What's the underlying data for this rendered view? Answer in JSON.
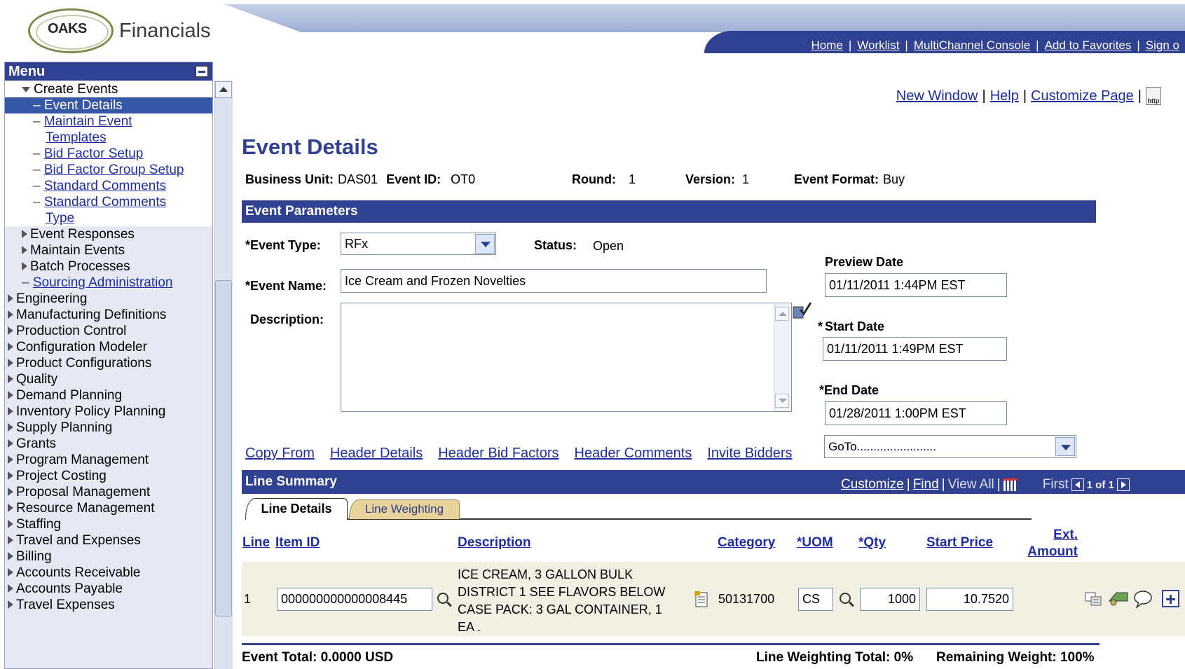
{
  "header": {
    "logo_text": "OAKS",
    "brand": "Financials",
    "nav": [
      "Home",
      "Worklist",
      "MultiChannel Console",
      "Add to Favorites",
      "Sign o"
    ]
  },
  "menu": {
    "title": "Menu",
    "items": [
      {
        "label": "Create Events",
        "level": 1,
        "type": "open"
      },
      {
        "label": "Event Details",
        "level": 2,
        "type": "selected"
      },
      {
        "label": "Maintain Event",
        "level": 2,
        "type": "link"
      },
      {
        "label": "Templates",
        "level": 2,
        "type": "link-cont"
      },
      {
        "label": "Bid Factor Setup",
        "level": 2,
        "type": "link"
      },
      {
        "label": "Bid Factor Group Setup",
        "level": 2,
        "type": "link"
      },
      {
        "label": "Standard Comments",
        "level": 2,
        "type": "link"
      },
      {
        "label": "Standard Comments",
        "level": 2,
        "type": "link"
      },
      {
        "label": "Type",
        "level": 2,
        "type": "link-cont"
      },
      {
        "label": "Event Responses",
        "level": 1,
        "type": "closed"
      },
      {
        "label": "Maintain Events",
        "level": 1,
        "type": "closed"
      },
      {
        "label": "Batch Processes",
        "level": 1,
        "type": "closed"
      },
      {
        "label": "Sourcing Administration",
        "level": 1,
        "type": "link"
      },
      {
        "label": "Engineering",
        "level": 0,
        "type": "closed"
      },
      {
        "label": "Manufacturing Definitions",
        "level": 0,
        "type": "closed"
      },
      {
        "label": "Production Control",
        "level": 0,
        "type": "closed"
      },
      {
        "label": "Configuration Modeler",
        "level": 0,
        "type": "closed"
      },
      {
        "label": "Product Configurations",
        "level": 0,
        "type": "closed"
      },
      {
        "label": "Quality",
        "level": 0,
        "type": "closed"
      },
      {
        "label": "Demand Planning",
        "level": 0,
        "type": "closed"
      },
      {
        "label": "Inventory Policy Planning",
        "level": 0,
        "type": "closed"
      },
      {
        "label": "Supply Planning",
        "level": 0,
        "type": "closed"
      },
      {
        "label": "Grants",
        "level": 0,
        "type": "closed"
      },
      {
        "label": "Program Management",
        "level": 0,
        "type": "closed"
      },
      {
        "label": "Project Costing",
        "level": 0,
        "type": "closed"
      },
      {
        "label": "Proposal Management",
        "level": 0,
        "type": "closed"
      },
      {
        "label": "Resource Management",
        "level": 0,
        "type": "closed"
      },
      {
        "label": "Staffing",
        "level": 0,
        "type": "closed"
      },
      {
        "label": "Travel and Expenses",
        "level": 0,
        "type": "closed"
      },
      {
        "label": "Billing",
        "level": 0,
        "type": "closed"
      },
      {
        "label": "Accounts Receivable",
        "level": 0,
        "type": "closed"
      },
      {
        "label": "Accounts Payable",
        "level": 0,
        "type": "closed"
      },
      {
        "label": "Travel Expenses",
        "level": 0,
        "type": "closed"
      }
    ]
  },
  "toplinks": {
    "new_window": "New Window",
    "help": "Help",
    "customize_page": "Customize Page",
    "http_icon": "http"
  },
  "page": {
    "title": "Event Details"
  },
  "keys": {
    "bu_label": "Business Unit:",
    "bu_value": "DAS01",
    "event_id_label": "Event ID:",
    "event_id_value": "OT0",
    "round_label": "Round:",
    "round_value": "1",
    "version_label": "Version:",
    "version_value": "1",
    "format_label": "Event Format:",
    "format_value": "Buy"
  },
  "params": {
    "bar_title": "Event Parameters",
    "event_type_label": "*Event Type:",
    "event_type_value": "RFx",
    "status_label": "Status:",
    "status_value": "Open",
    "event_name_label": "*Event Name:",
    "event_name_value": "Ice Cream and Frozen Novelties",
    "description_label": "Description:",
    "description_value": "",
    "preview_label": "Preview Date",
    "preview_value": "01/11/2011  1:44PM EST",
    "start_star": "*",
    "start_label": "Start Date",
    "start_value": "01/11/2011  1:49PM EST",
    "end_label": "*End Date",
    "end_value": "01/28/2011  1:00PM EST"
  },
  "links": [
    "Copy From",
    "Header Details",
    "Header Bid Factors",
    "Header Comments",
    "Invite Bidders"
  ],
  "goto": {
    "value": "GoTo........................"
  },
  "summary": {
    "title": "Line Summary",
    "customize": "Customize",
    "find": "Find",
    "view_all": "View All",
    "first": "First",
    "range": "1 of 1"
  },
  "tabs": {
    "details": "Line Details",
    "weighting": "Line Weighting"
  },
  "grid": {
    "headers": {
      "line": "Line",
      "item_id": "Item ID",
      "description": "Description",
      "category": "Category",
      "uom": "*UOM",
      "qty": "*Qty",
      "start_price": "Start Price",
      "ext_amount_1": "Ext.",
      "ext_amount_2": "Amount"
    },
    "rows": [
      {
        "line": "1",
        "item_id": "000000000000008445",
        "desc_1": "ICE CREAM, 3 GALLON BULK",
        "desc_2": "DISTRICT 1 SEE FLAVORS BELOW",
        "desc_3": "CASE PACK: 3 GAL CONTAINER, 1",
        "desc_4": "EA .",
        "category": "50131700",
        "uom": "CS",
        "qty": "1000",
        "start_price": "10.7520"
      }
    ]
  },
  "footer": {
    "event_total": "Event Total: 0.0000 USD",
    "line_weighting": "Line Weighting Total: 0%",
    "remaining": "Remaining Weight: 100%"
  },
  "colors": {
    "bar": "#2f4190",
    "link": "#1f2e9c",
    "tab_inactive": "#e8d39a"
  }
}
